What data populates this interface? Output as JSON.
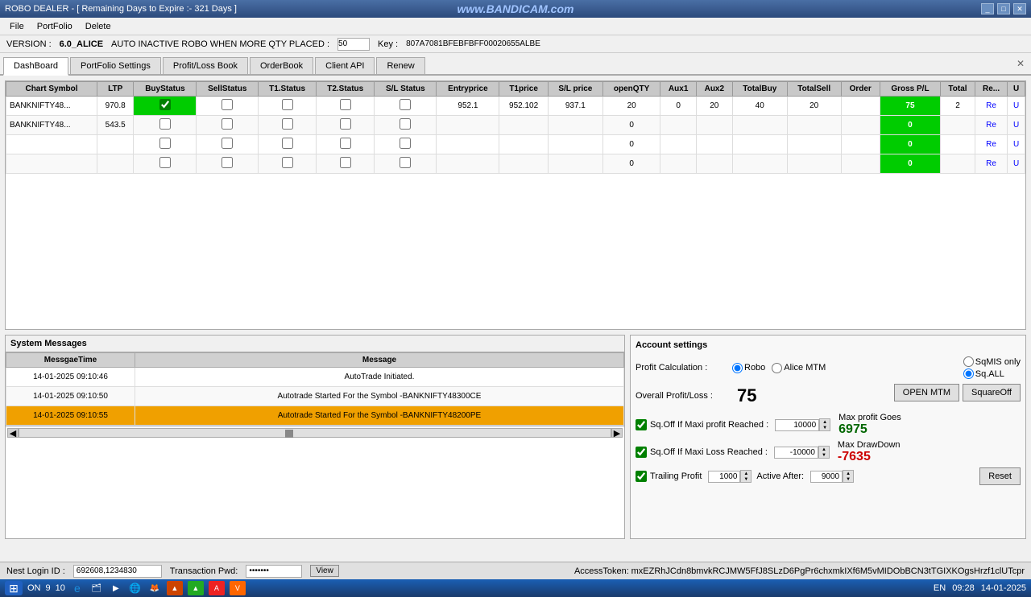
{
  "titlebar": {
    "title": "ROBO DEALER  - [ Remaining Days to Expire :- 321 Days ]",
    "watermark": "www.BANDICAM.com",
    "controls": [
      "_",
      "□",
      "✕"
    ]
  },
  "menubar": {
    "items": [
      "File",
      "PortFolio",
      "Delete"
    ]
  },
  "versionbar": {
    "version_label": "VERSION :",
    "version_value": "6.0_ALICE",
    "inactive_label": "AUTO INACTIVE ROBO WHEN MORE QTY PLACED :",
    "inactive_value": "50",
    "key_label": "Key :",
    "key_value": "807A7081BFEBFBFF00020655ALBE"
  },
  "tabs": {
    "items": [
      "DashBoard",
      "PortFolio Settings",
      "Profit/Loss Book",
      "OrderBook",
      "Client API",
      "Renew"
    ],
    "active": 0
  },
  "table": {
    "headers": [
      "Chart Symbol",
      "LTP",
      "BuyStatus",
      "SellStatus",
      "T1.Status",
      "T2.Status",
      "S/L Status",
      "Entryprice",
      "T1price",
      "S/L price",
      "openQTY",
      "Aux1",
      "Aux2",
      "TotalBuy",
      "TotalSell",
      "Order",
      "Gross P/L",
      "Total",
      "Re...",
      "U"
    ],
    "rows": [
      {
        "symbol": "BANKNIFTY48...",
        "ltp": "970.8",
        "buy_checked": true,
        "sell_checked": false,
        "t1_checked": false,
        "t2_checked": false,
        "sl_checked": false,
        "entry": "952.1",
        "t1price": "952.102",
        "sl_price": "937.1",
        "openqty": "20",
        "aux1": "0",
        "aux2": "20",
        "totalbuy": "40",
        "totalsell": "20",
        "order": "",
        "gross_pl": "75",
        "total": "2",
        "re": "Re",
        "u": "U",
        "buy_green": true,
        "pl_green": true
      },
      {
        "symbol": "BANKNIFTY48...",
        "ltp": "543.5",
        "buy_checked": false,
        "sell_checked": false,
        "t1_checked": false,
        "t2_checked": false,
        "sl_checked": false,
        "entry": "",
        "t1price": "",
        "sl_price": "",
        "openqty": "0",
        "aux1": "",
        "aux2": "",
        "totalbuy": "",
        "totalsell": "",
        "order": "",
        "gross_pl": "0",
        "total": "",
        "re": "Re",
        "u": "U",
        "buy_green": false,
        "pl_green": true
      },
      {
        "symbol": "",
        "ltp": "",
        "buy_checked": false,
        "sell_checked": false,
        "t1_checked": false,
        "t2_checked": false,
        "sl_checked": false,
        "entry": "",
        "t1price": "",
        "sl_price": "",
        "openqty": "0",
        "aux1": "",
        "aux2": "",
        "totalbuy": "",
        "totalsell": "",
        "order": "",
        "gross_pl": "0",
        "total": "",
        "re": "Re",
        "u": "U",
        "buy_green": false,
        "pl_green": true
      },
      {
        "symbol": "",
        "ltp": "",
        "buy_checked": false,
        "sell_checked": false,
        "t1_checked": false,
        "t2_checked": false,
        "sl_checked": false,
        "entry": "",
        "t1price": "",
        "sl_price": "",
        "openqty": "0",
        "aux1": "",
        "aux2": "",
        "totalbuy": "",
        "totalsell": "",
        "order": "",
        "gross_pl": "0",
        "total": "",
        "re": "Re",
        "u": "U",
        "buy_green": false,
        "pl_green": true
      }
    ]
  },
  "system_messages": {
    "header": "System Messages",
    "col_time": "MessgaeTime",
    "col_msg": "Message",
    "rows": [
      {
        "time": "14-01-2025 09:10:46",
        "message": "AutoTrade Initiated.",
        "highlight": false
      },
      {
        "time": "14-01-2025 09:10:50",
        "message": "Autotrade Started For the Symbol -BANKNIFTY48300CE",
        "highlight": false
      },
      {
        "time": "14-01-2025 09:10:55",
        "message": "Autotrade Started For the Symbol -BANKNIFTY48200PE",
        "highlight": true
      }
    ]
  },
  "account_settings": {
    "header": "Account settings",
    "profit_calc_label": "Profit Calculation :",
    "radio_robo": "Robo",
    "radio_alice": "Alice MTM",
    "overall_pl_label": "Overall Profit/Loss :",
    "overall_pl_value": "75",
    "btn_open_mtm": "OPEN MTM",
    "btn_square_off": "SquareOff",
    "radio_sqmis": "SqMIS only",
    "radio_sqall": "Sq.ALL",
    "sq_off_profit_label": "Sq.Off If Maxi profit Reached :",
    "sq_off_profit_value": "10000",
    "sq_off_loss_label": "Sq.Off If Maxi Loss Reached :",
    "sq_off_loss_value": "-10000",
    "trailing_label": "Trailing Profit",
    "trailing_value": "1000",
    "active_after_label": "Active After:",
    "active_after_value": "9000",
    "max_profit_label": "Max profit Goes",
    "max_profit_value": "6975",
    "max_drawdown_label": "Max DrawDown",
    "max_drawdown_value": "-7635",
    "reset_btn": "Reset"
  },
  "statusbar": {
    "nest_login_label": "Nest Login ID :",
    "nest_login_value": "692608,1234830",
    "transaction_pwd_label": "Transaction Pwd:",
    "transaction_pwd_value": "*******",
    "view_btn": "View",
    "access_token_label": "AccessToken:",
    "access_token_value": "mxEZRhJCdn8bmvkRCJMW5FfJ8SLzD6PgPr6chxmkIXf6M5vMIDObBCN3tTGIXKOgsHrzf1clUTcpr"
  },
  "taskbar": {
    "on_label": "ON",
    "num1": "9",
    "num2": "10",
    "lang": "EN",
    "time": "09:28",
    "date": "14-01-2025"
  }
}
